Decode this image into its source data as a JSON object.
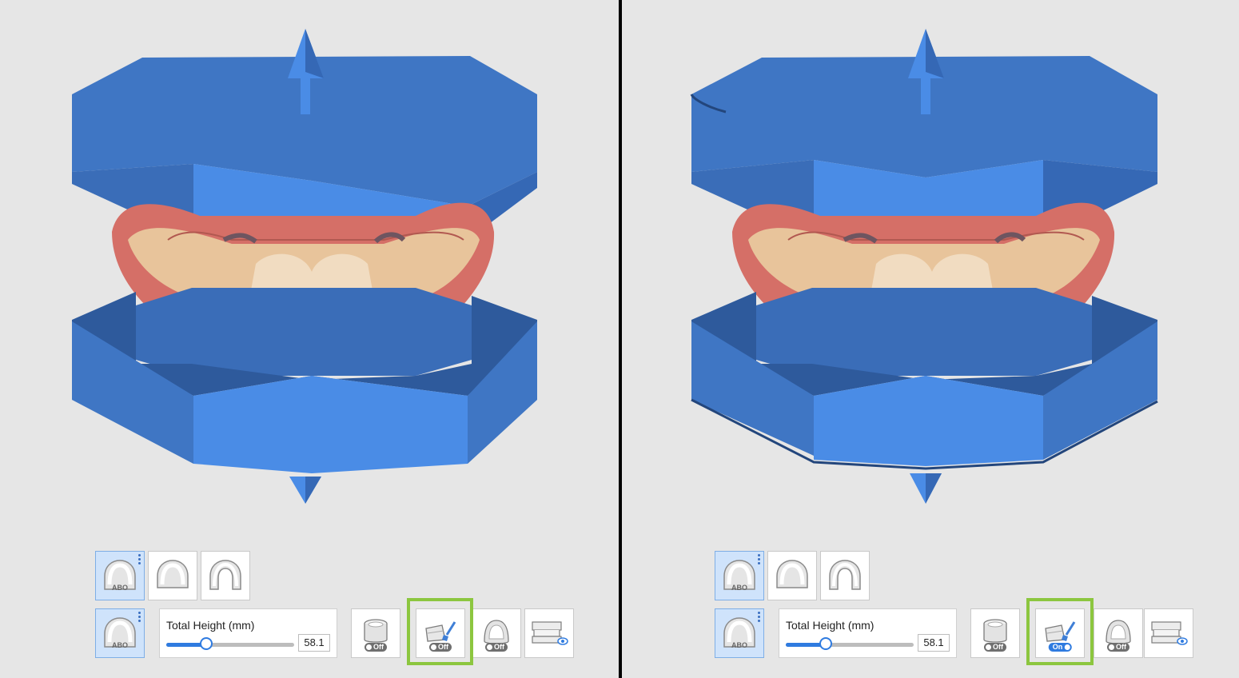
{
  "panels": [
    {
      "id": "left",
      "height": {
        "label": "Total Height (mm)",
        "value": "58.1",
        "fraction": 0.31
      },
      "toolbar": {
        "base_types": [
          "abo-base-icon",
          "arch-base-icon",
          "horseshoe-base-icon"
        ],
        "abo_text": "ABO",
        "toggles": [
          {
            "name": "hollow-base-toggle",
            "state": "Off"
          },
          {
            "name": "smooth-brush-toggle",
            "state": "Off"
          },
          {
            "name": "palate-fill-toggle",
            "state": "Off"
          }
        ],
        "highlighted": "smooth-brush-toggle"
      }
    },
    {
      "id": "right",
      "height": {
        "label": "Total Height (mm)",
        "value": "58.1",
        "fraction": 0.31
      },
      "toolbar": {
        "base_types": [
          "abo-base-icon",
          "arch-base-icon",
          "horseshoe-base-icon"
        ],
        "abo_text": "ABO",
        "toggles": [
          {
            "name": "hollow-base-toggle",
            "state": "Off"
          },
          {
            "name": "smooth-brush-toggle",
            "state": "On"
          },
          {
            "name": "palate-fill-toggle",
            "state": "Off"
          }
        ],
        "highlighted": "smooth-brush-toggle"
      }
    }
  ],
  "colors": {
    "background": "#e6e6e6",
    "base_blue": "#4a8ce6",
    "base_blue_dark": "#3568b5",
    "selected_bg": "#cfe3fb",
    "highlight_green": "#8cc63f",
    "toggle_on": "#2f7be0",
    "toggle_off": "#6f6f6f",
    "gingiva": "#d56f67",
    "teeth": "#efd2ae"
  }
}
